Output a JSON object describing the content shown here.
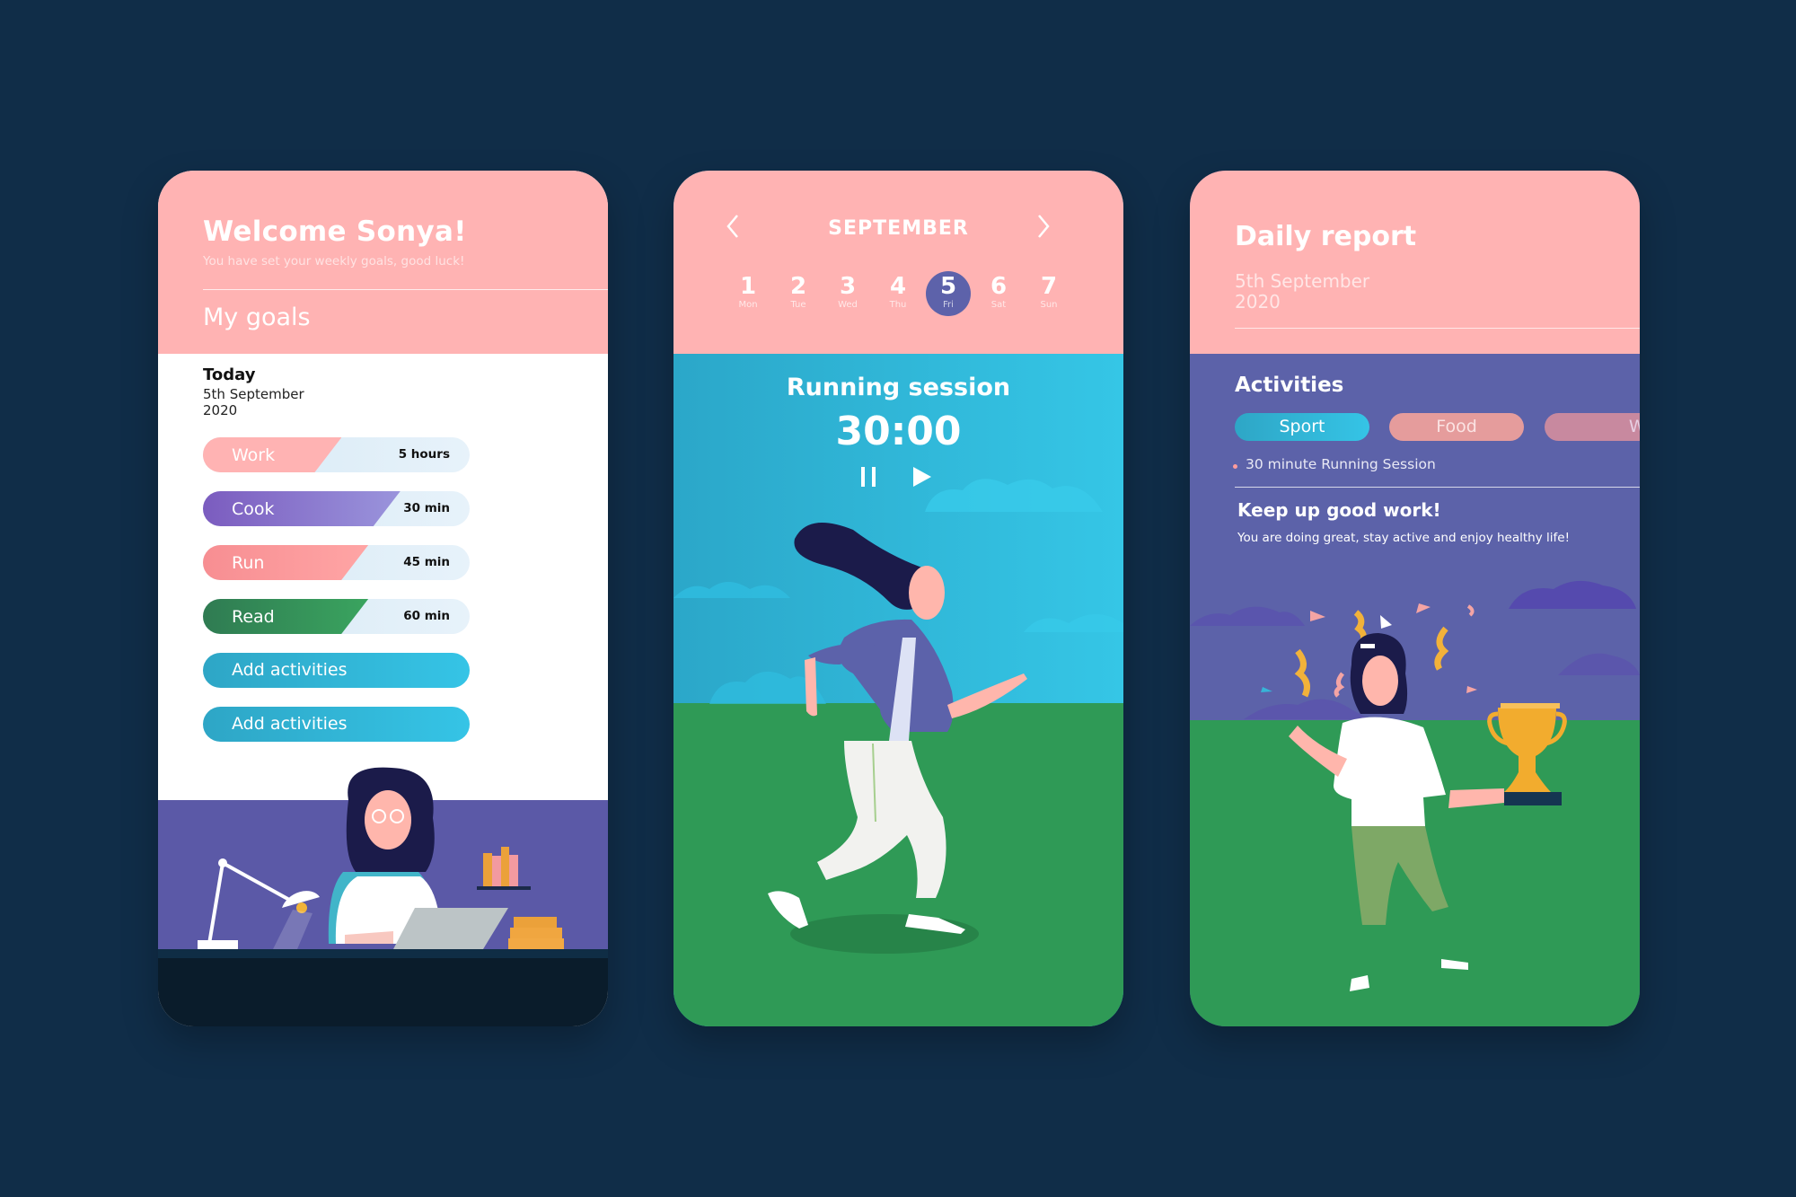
{
  "colors": {
    "background": "#102d48",
    "header_pink": "#ffb3b3",
    "accent_purple": "#5d62aa",
    "sky_blue": "#35c4e6",
    "grass_green": "#2f9a56"
  },
  "welcome_screen": {
    "title": "Welcome Sonya!",
    "subtitle": "You have set your weekly goals, good luck!",
    "section_title": "My goals",
    "today_label": "Today",
    "date_line1": "5th September",
    "date_line2": "2020",
    "goals": [
      {
        "label": "Work",
        "value": "5 hours",
        "progress": 0.52,
        "color_start": "#ffb3b3",
        "color_end": "#ffb3b3"
      },
      {
        "label": "Cook",
        "value": "30 min",
        "progress": 0.74,
        "color_start": "#7b5cbf",
        "color_end": "#9a94dc"
      },
      {
        "label": "Run",
        "value": "45 min",
        "progress": 0.62,
        "color_start": "#f78e92",
        "color_end": "#ffa5a5"
      },
      {
        "label": "Read",
        "value": "60 min",
        "progress": 0.62,
        "color_start": "#2f7b52",
        "color_end": "#3aa45f"
      }
    ],
    "add_buttons": [
      {
        "label": "Add activities"
      },
      {
        "label": "Add activities"
      }
    ],
    "illustration": "woman-working-at-laptop"
  },
  "session_screen": {
    "month": "SEPTEMBER",
    "prev_icon": "chevron-left-icon",
    "next_icon": "chevron-right-icon",
    "days": [
      {
        "num": "1",
        "name": "Mon"
      },
      {
        "num": "2",
        "name": "Tue"
      },
      {
        "num": "3",
        "name": "Wed"
      },
      {
        "num": "4",
        "name": "Thu"
      },
      {
        "num": "5",
        "name": "Fri",
        "selected": true
      },
      {
        "num": "6",
        "name": "Sat"
      },
      {
        "num": "7",
        "name": "Sun"
      }
    ],
    "session_title": "Running session",
    "timer": "30:00",
    "pause_icon": "pause-icon",
    "play_icon": "play-icon",
    "illustration": "woman-running"
  },
  "report_screen": {
    "title": "Daily report",
    "date_line1": "5th September",
    "date_line2": "2020",
    "activities_title": "Activities",
    "categories": [
      {
        "label": "Sport",
        "active": true
      },
      {
        "label": "Food",
        "active": false
      },
      {
        "label": "Work",
        "active": false
      }
    ],
    "activity_items": [
      "30 minute Running Session"
    ],
    "encouragement_title": "Keep up good work!",
    "encouragement_text": "You are doing great, stay active and enjoy healthy life!",
    "illustration": "woman-holding-trophy"
  }
}
